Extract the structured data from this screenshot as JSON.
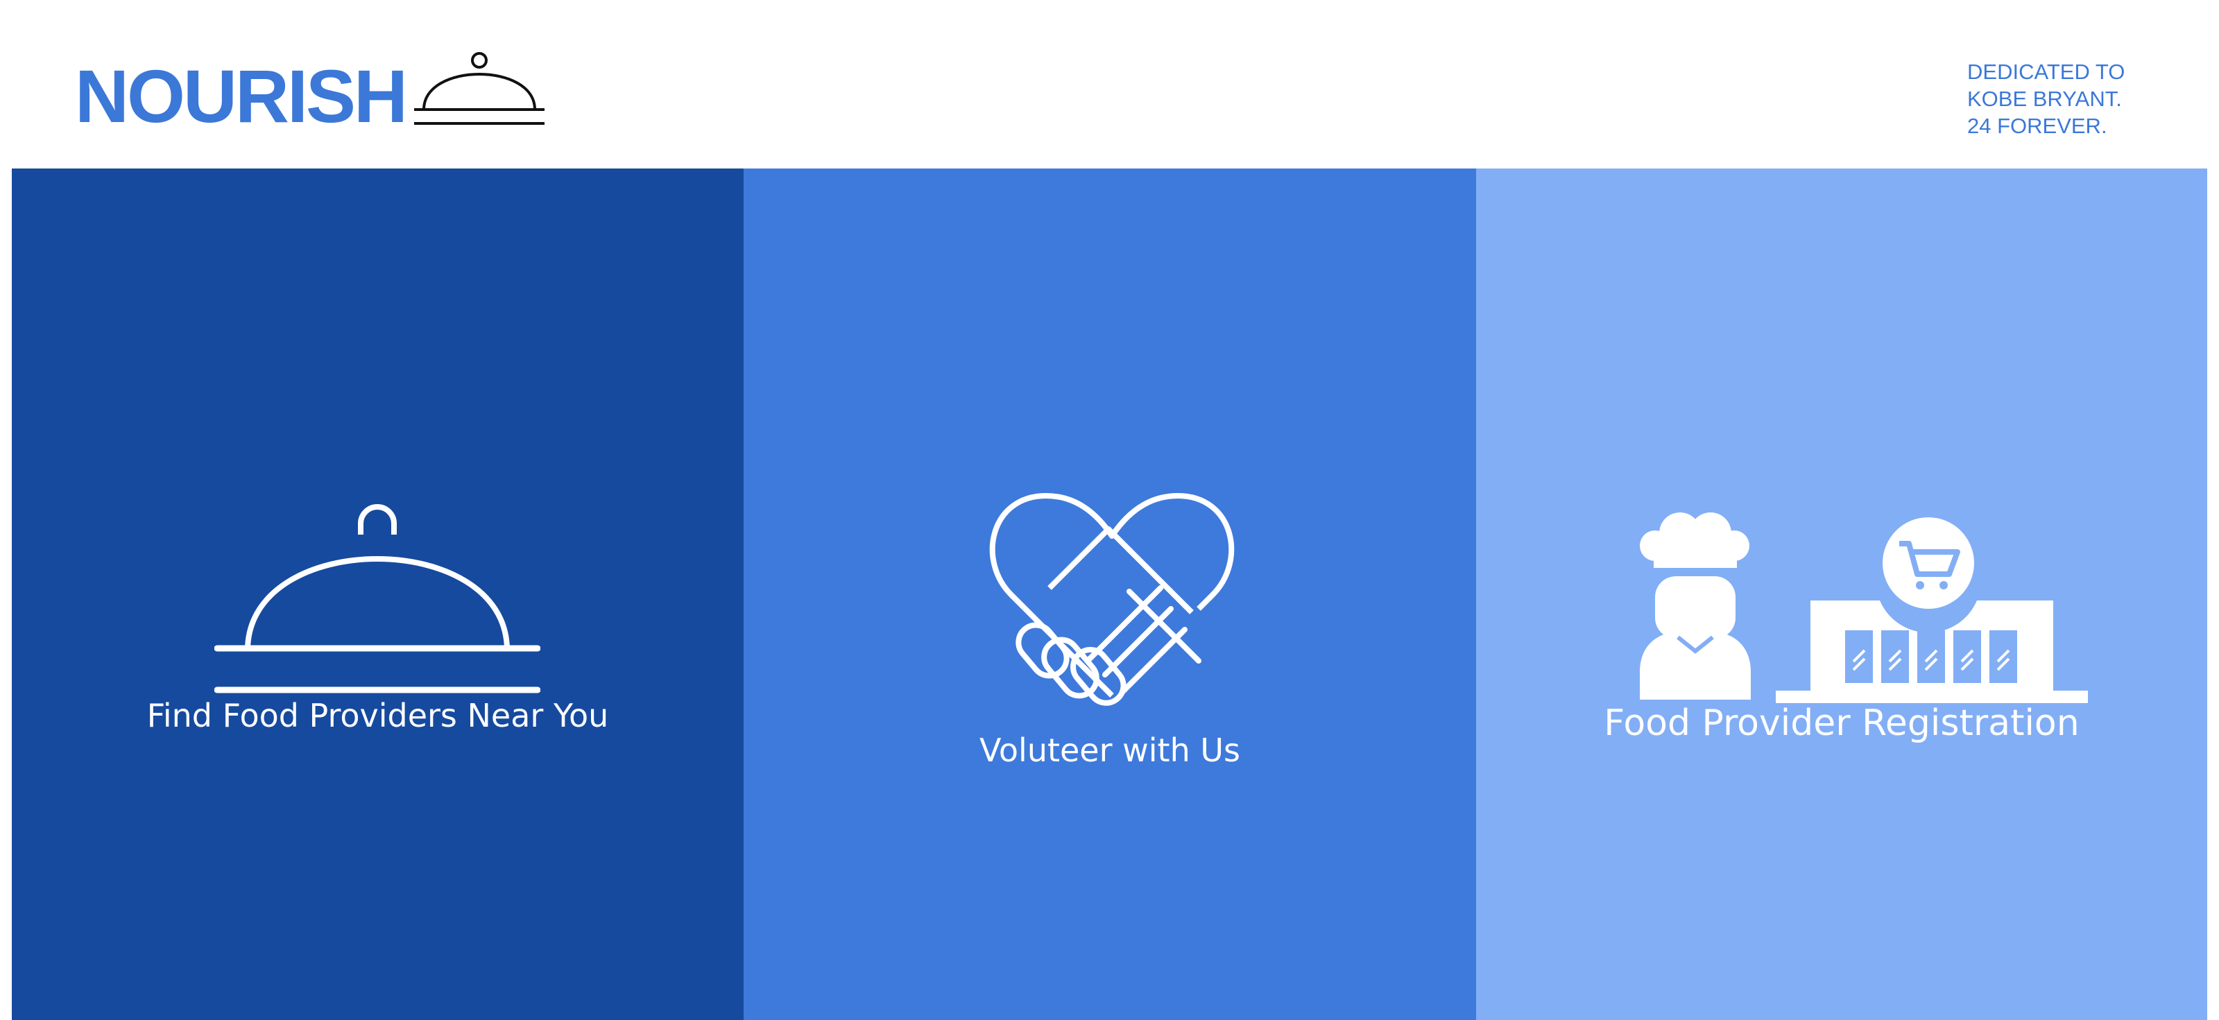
{
  "header": {
    "logo_text": "NOURISH",
    "logo_icon": "cloche-icon",
    "dedication": [
      "DEDICATED TO",
      "KOBE BRYANT.",
      "24 FOREVER."
    ]
  },
  "panels": [
    {
      "label": "Find Food Providers Near You",
      "icon": "cloche-icon",
      "color": "#164a9e"
    },
    {
      "label": "Voluteer with Us",
      "icon": "heart-handshake-icon",
      "color": "#3e7adb"
    },
    {
      "label": "Food Provider Registration",
      "icon": "chef-and-store-icon",
      "color": "#82aef5"
    }
  ],
  "colors": {
    "brand": "#3b78d8",
    "background": "#ffffff"
  }
}
